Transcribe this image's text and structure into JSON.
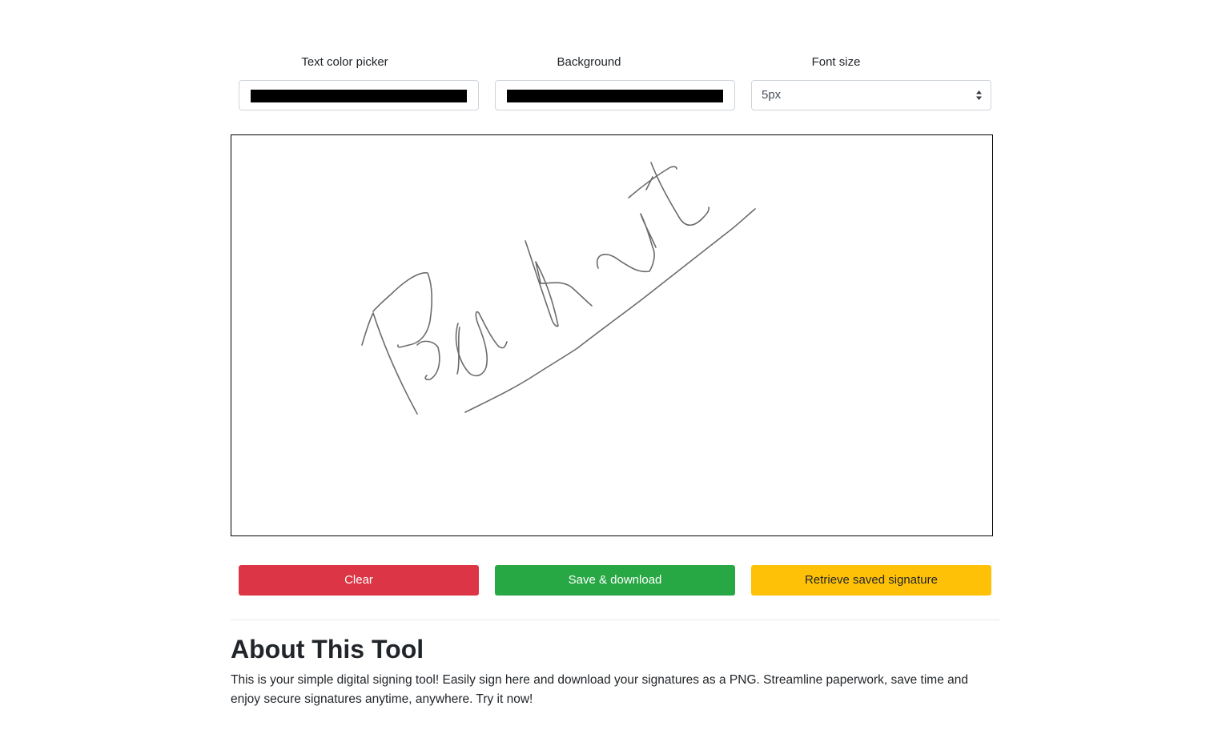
{
  "controls": {
    "text_color_label": "Text color picker",
    "text_color_value": "#000000",
    "background_label": "Background",
    "background_value": "#000000",
    "font_size_label": "Font size",
    "font_size_value": "5px"
  },
  "canvas": {
    "border_color": "#000000",
    "stroke_color": "#6b6b6b",
    "content": "handwritten signature"
  },
  "buttons": {
    "clear_label": "Clear",
    "save_label": "Save & download",
    "retrieve_label": "Retrieve saved signature"
  },
  "colors": {
    "danger": "#dc3545",
    "success": "#28a745",
    "warning": "#ffc107"
  },
  "about": {
    "title": "About This Tool",
    "body": "This is your simple digital signing tool! Easily sign here and download your signatures as a PNG. Streamline paperwork, save time and enjoy secure signatures anytime, anywhere. Try it now!"
  },
  "icons": {
    "select_arrow": "sort-arrows-icon"
  }
}
